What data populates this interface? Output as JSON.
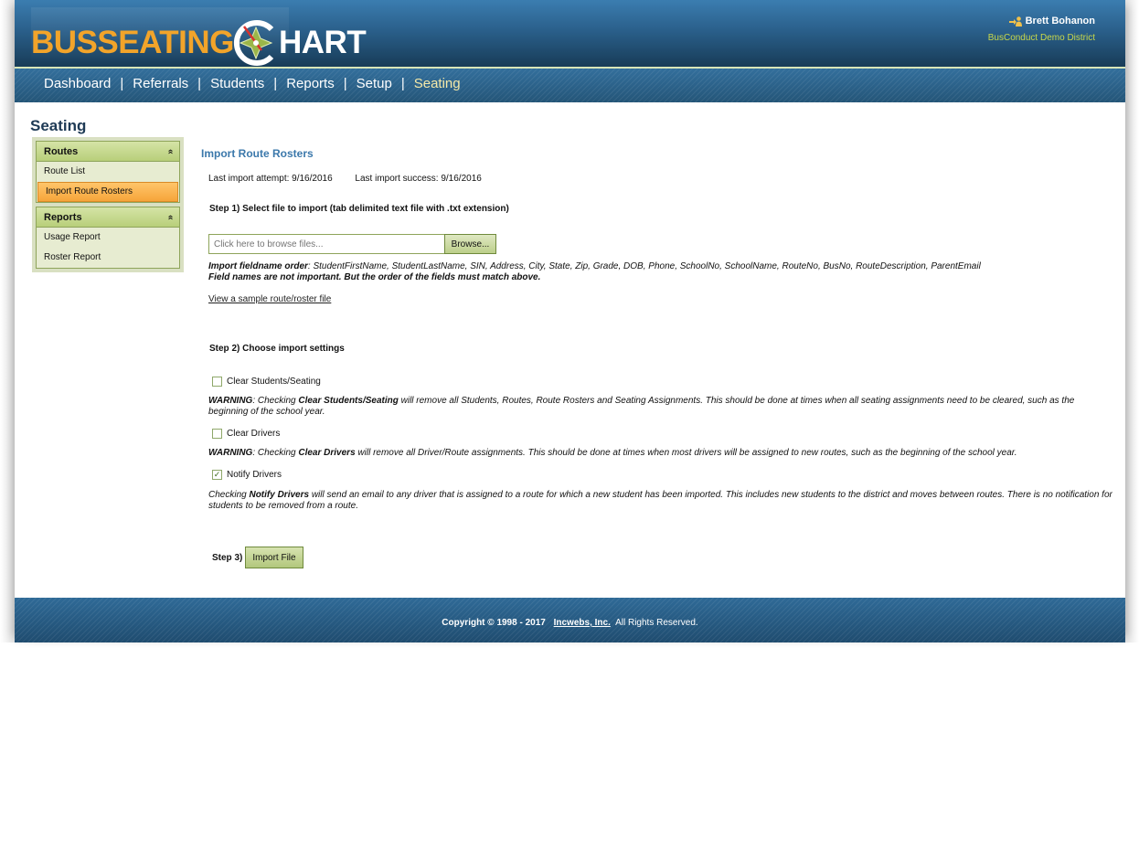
{
  "brand": {
    "logo_part1": "BUSSEATING",
    "logo_part2": "HART",
    "logo_icon": "compass-c-icon"
  },
  "user": {
    "name": "Brett Bohanon",
    "district": "BusConduct Demo District",
    "icon": "user-switch-icon"
  },
  "nav": {
    "items": [
      "Dashboard",
      "Referrals",
      "Students",
      "Reports",
      "Setup",
      "Seating"
    ],
    "separator": "|",
    "active": "Seating"
  },
  "page": {
    "title": "Seating"
  },
  "sidebar": {
    "routes": {
      "heading": "Routes",
      "items": [
        "Route List",
        "Import Route Rosters"
      ],
      "selected": "Import Route Rosters"
    },
    "reports": {
      "heading": "Reports",
      "items": [
        "Usage Report",
        "Roster Report"
      ]
    },
    "collapse_glyph": "»"
  },
  "content": {
    "section_title": "Import Route Rosters",
    "last_attempt": "Last import attempt: 9/16/2016",
    "last_success": "Last import success: 9/16/2016",
    "step1": "Step 1) Select file to import (tab delimited text file with .txt extension)",
    "file_placeholder": "Click here to browse files...",
    "browse_label": "Browse...",
    "fieldorder_label": "Import fieldname order",
    "fieldorder_value": ": StudentFirstName, StudentLastName, SIN, Address, City, State, Zip, Grade, DOB, Phone, SchoolNo, SchoolName, RouteNo, BusNo, RouteDescription, ParentEmail",
    "fieldnote": "Field names are not important. But the order of the fields must match above.",
    "sample_link": "View a sample route/roster file",
    "step2": "Step 2) Choose import settings",
    "options": [
      {
        "label": "Clear Students/Seating",
        "checked": false,
        "note_prefix": "WARNING",
        "note_mid": ": Checking ",
        "note_bold": "Clear Students/Seating",
        "note_rest": " will remove all Students, Routes, Route Rosters and Seating Assignments. This should be done at times when all seating assignments need to be cleared, such as the beginning of the school year."
      },
      {
        "label": "Clear Drivers",
        "checked": false,
        "note_prefix": "WARNING",
        "note_mid": ": Checking ",
        "note_bold": "Clear Drivers",
        "note_rest": " will remove all Driver/Route assignments. This should be done at times when most drivers will be assigned to new routes, such as the beginning of the school year."
      },
      {
        "label": "Notify Drivers",
        "checked": true,
        "note_prefix": "",
        "note_mid": "Checking ",
        "note_bold": "Notify Drivers",
        "note_rest": " will send an email to any driver that is assigned to a route for which a new student has been imported. This includes new students to the district and moves between routes. There is no notification for students to be removed from a route."
      }
    ],
    "check_glyph": "✓",
    "step3": "Step 3)",
    "import_label": "Import File"
  },
  "footer": {
    "copyright": "Copyright © 1998 - 2017",
    "company": "Incwebs, Inc.",
    "rights": "All Rights Reserved."
  },
  "colors": {
    "header_blue": "#2a5f8a",
    "logo_orange": "#f2a42a",
    "nav_active": "#f5e9a8",
    "district_green": "#c8d84a",
    "section_title": "#3b78ab",
    "selected_item": "#f6a53a",
    "panel_green": "#b8cf7a"
  }
}
